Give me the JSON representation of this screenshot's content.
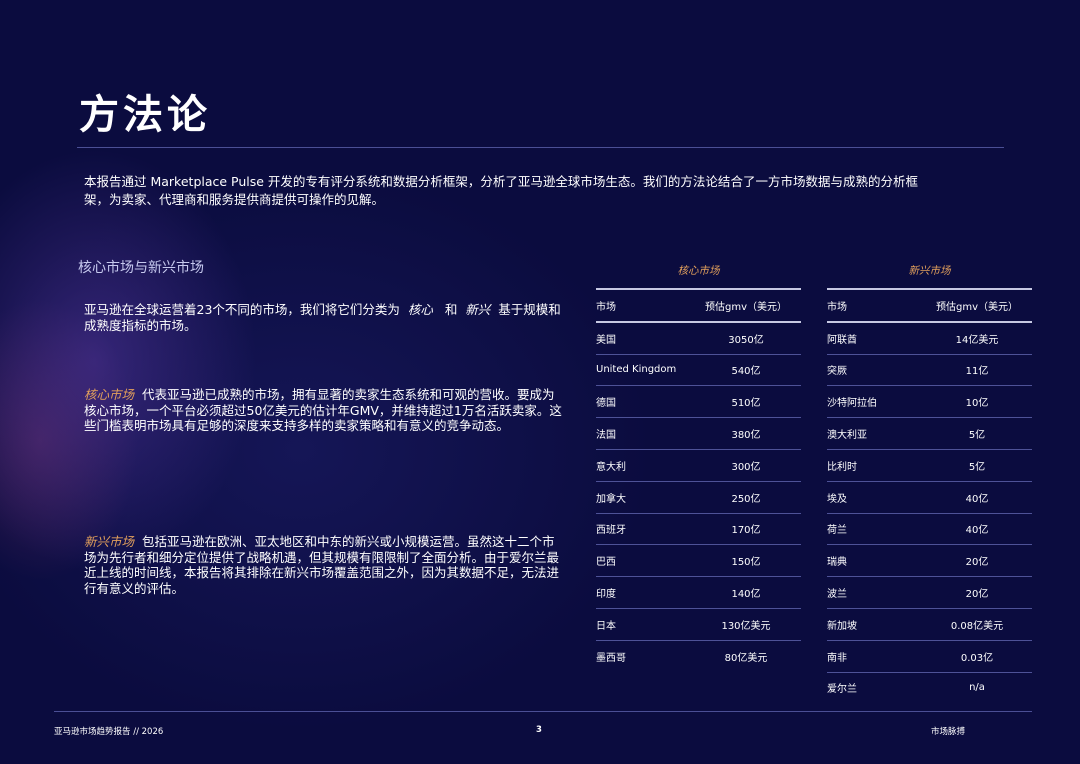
{
  "title": "方法论",
  "intro": "本报告通过 Marketplace Pulse 开发的专有评分系统和数据分析框架，分析了亚马逊全球市场生态。我们的方法论结合了一方市场数据与成熟的分析框架，为卖家、代理商和服务提供商提供可操作的见解。",
  "section_title": "核心市场与新兴市场",
  "para1": {
    "text_before": "亚马逊在全球运营着23个不同的市场，我们将它们分类为",
    "term_core": "核心",
    "conj": "和",
    "term_emerging": "新兴",
    "text_after": "基于规模和成熟度指标的市场。"
  },
  "para2": {
    "term": "核心市场",
    "text": "代表亚马逊已成熟的市场，拥有显著的卖家生态系统和可观的营收。要成为核心市场，一个平台必须超过50亿美元的估计年GMV，并维持超过1万名活跃卖家。这些门槛表明市场具有足够的深度来支持多样的卖家策略和有意义的竞争动态。"
  },
  "para3": {
    "term": "新兴市场",
    "text": "包括亚马逊在欧洲、亚太地区和中东的新兴或小规模运营。虽然这十二个市场为先行者和细分定位提供了战略机遇，但其规模有限限制了全面分析。由于爱尔兰最近上线的时间线，本报告将其排除在新兴市场覆盖范围之外，因为其数据不足，无法进行有意义的评估。"
  },
  "core_table": {
    "caption": "核心市场",
    "headers": [
      "市场",
      "预估gmv（美元）"
    ],
    "rows": [
      [
        "美国",
        "3050亿"
      ],
      [
        "United Kingdom",
        "540亿"
      ],
      [
        "德国",
        "510亿"
      ],
      [
        "法国",
        "380亿"
      ],
      [
        "意大利",
        "300亿"
      ],
      [
        "加拿大",
        "250亿"
      ],
      [
        "西班牙",
        "170亿"
      ],
      [
        "巴西",
        "150亿"
      ],
      [
        "印度",
        "140亿"
      ],
      [
        "日本",
        "130亿美元"
      ],
      [
        "墨西哥",
        "80亿美元"
      ]
    ]
  },
  "emerging_table": {
    "caption": "新兴市场",
    "headers": [
      "市场",
      "预估gmv（美元）"
    ],
    "rows": [
      [
        "阿联酋",
        "14亿美元"
      ],
      [
        "突厥",
        "11亿"
      ],
      [
        "沙特阿拉伯",
        "10亿"
      ],
      [
        "澳大利亚",
        "5亿"
      ],
      [
        "比利时",
        "5亿"
      ],
      [
        "埃及",
        "40亿"
      ],
      [
        "荷兰",
        "40亿"
      ],
      [
        "瑞典",
        "20亿"
      ],
      [
        "波兰",
        "20亿"
      ],
      [
        "新加坡",
        "0.08亿美元"
      ],
      [
        "南非",
        "0.03亿"
      ],
      [
        "爱尔兰",
        "n/a"
      ]
    ]
  },
  "footer": {
    "left": "亚马逊市场趋势报告 // 2026",
    "page": "3",
    "right": "市场脉搏"
  },
  "colors": {
    "background": "#0b0c3f",
    "accent": "#e2a05c",
    "rule": "#4b4f95",
    "section_title": "#c6c9ee"
  }
}
